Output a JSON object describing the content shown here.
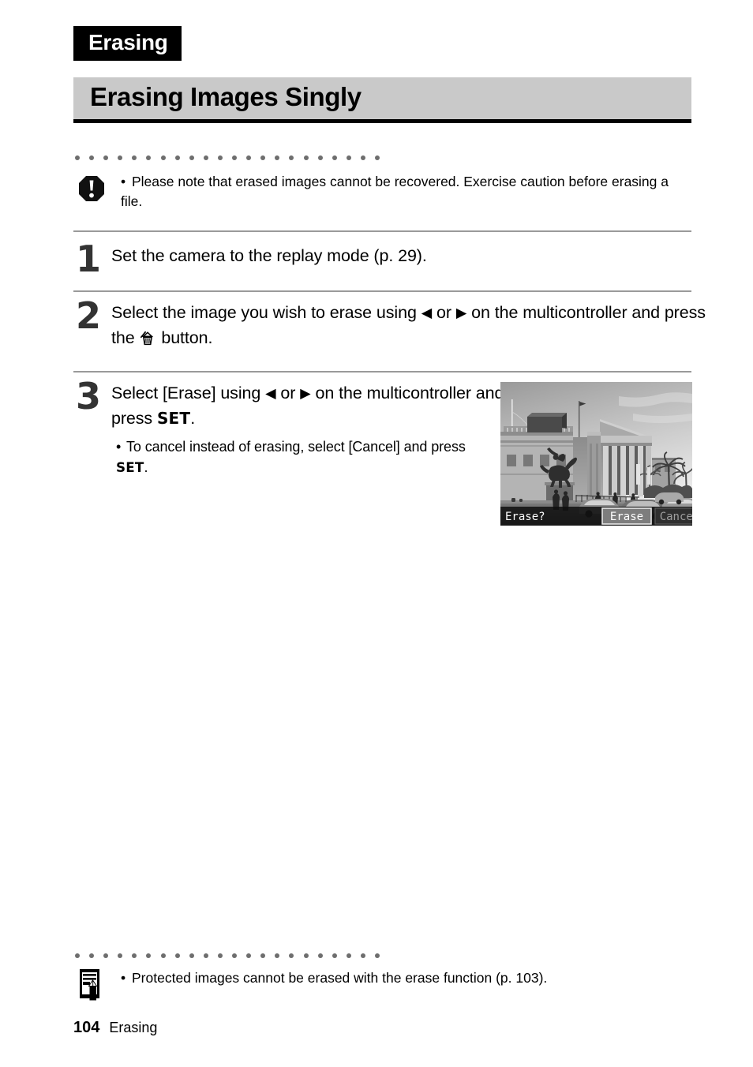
{
  "chapter_tab": {
    "label": "Erasing"
  },
  "section": {
    "title": "Erasing Images Singly"
  },
  "caution": {
    "icon": "caution-octagon-icon",
    "bullet": "•",
    "text": "Please note that erased images cannot be recovered. Exercise caution before erasing a file."
  },
  "steps": [
    {
      "number": "1",
      "text_before": "Set the camera to the replay mode (p. 29).",
      "text_after": ""
    },
    {
      "number": "2",
      "part1": "Select the image you wish to erase using ",
      "left_arrow": "◀",
      "or": " or ",
      "right_arrow": "▶",
      "part2": " on the multicontroller and press the ",
      "trash_icon": "trash-can-icon",
      "part3": " button."
    },
    {
      "number": "3",
      "part1": "Select [Erase] using ",
      "left_arrow": "◀",
      "or": " or ",
      "right_arrow": "▶",
      "part2": " on the multicontroller and press ",
      "set_label": "SET",
      "part3": ".",
      "sub_note": {
        "bullet": "•",
        "part1": "To cancel instead of erasing, select [Cancel] and press ",
        "set_label": "SET",
        "part2": "."
      }
    }
  ],
  "lcd_screenshot": {
    "alt": "Camera LCD showing a photograph of a neoclassical museum building with columns, an equestrian statue and palm trees, overlaid with an erase confirmation bar",
    "prompt": "Erase?",
    "option_erase": "Erase",
    "option_cancel": "Cancel",
    "selected_option": "Erase",
    "colors": {
      "selected_text": "#ffffff",
      "selected_box": "#808080",
      "unselected_text": "#a0a0a0",
      "unselected_box": "#3a3a3a",
      "bar_background": "#141414"
    }
  },
  "footer_note": {
    "icon": "memo-pencil-icon",
    "bullet": "•",
    "text": "Protected images cannot be erased with the erase function (p. 103)."
  },
  "page_footer": {
    "page_number": "104",
    "chapter": "Erasing"
  },
  "dot_rule": {
    "count": 22
  },
  "colors": {
    "tab_background": "#000000",
    "tab_text": "#ffffff",
    "banner_background": "#c9c9c9",
    "banner_underline": "#000000",
    "rule": "#9a9a9a",
    "dot": "#6e6e6e",
    "step_number": "#333333"
  }
}
